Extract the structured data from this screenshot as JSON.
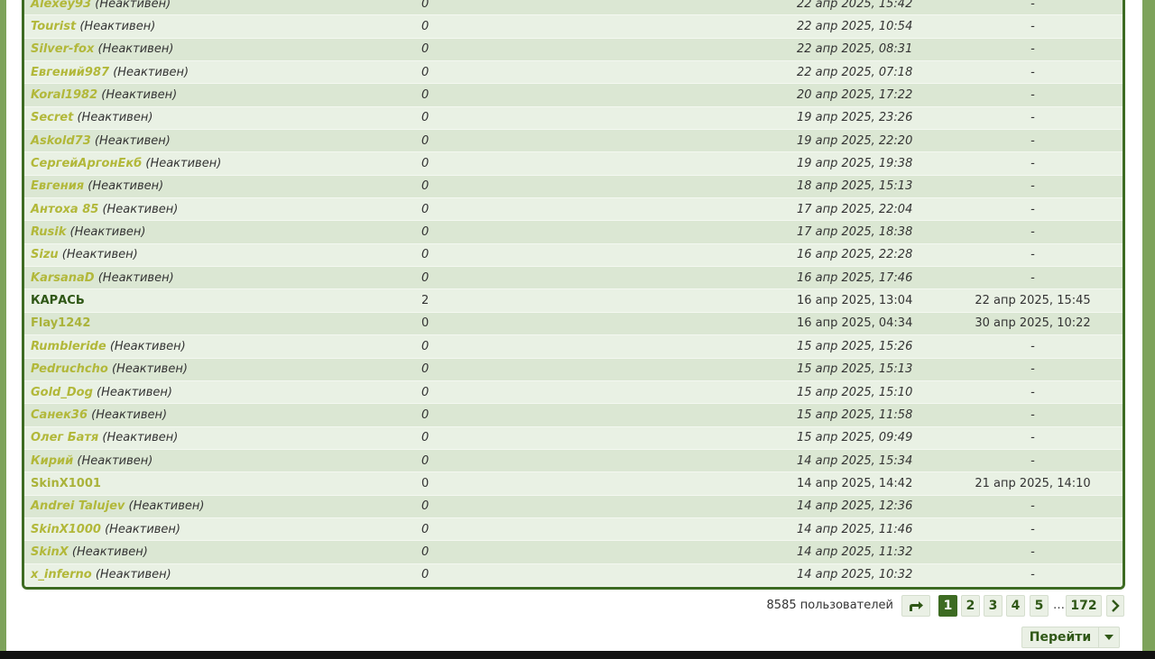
{
  "members": [
    {
      "name": "Alexey93",
      "status": "(Неактивен)",
      "messages": "0",
      "registered": "22 апр 2025, 15:42",
      "last": "-",
      "active": false
    },
    {
      "name": "Tourist",
      "status": "(Неактивен)",
      "messages": "0",
      "registered": "22 апр 2025, 10:54",
      "last": "-",
      "active": false
    },
    {
      "name": "Silver-fox",
      "status": "(Неактивен)",
      "messages": "0",
      "registered": "22 апр 2025, 08:31",
      "last": "-",
      "active": false
    },
    {
      "name": "Евгений987",
      "status": "(Неактивен)",
      "messages": "0",
      "registered": "22 апр 2025, 07:18",
      "last": "-",
      "active": false
    },
    {
      "name": "Koral1982",
      "status": "(Неактивен)",
      "messages": "0",
      "registered": "20 апр 2025, 17:22",
      "last": "-",
      "active": false
    },
    {
      "name": "Secret",
      "status": "(Неактивен)",
      "messages": "0",
      "registered": "19 апр 2025, 23:26",
      "last": "-",
      "active": false
    },
    {
      "name": "Askold73",
      "status": "(Неактивен)",
      "messages": "0",
      "registered": "19 апр 2025, 22:20",
      "last": "-",
      "active": false
    },
    {
      "name": "СергейАргонЕкб",
      "status": "(Неактивен)",
      "messages": "0",
      "registered": "19 апр 2025, 19:38",
      "last": "-",
      "active": false
    },
    {
      "name": "Евгения",
      "status": "(Неактивен)",
      "messages": "0",
      "registered": "18 апр 2025, 15:13",
      "last": "-",
      "active": false
    },
    {
      "name": "Антоха 85",
      "status": "(Неактивен)",
      "messages": "0",
      "registered": "17 апр 2025, 22:04",
      "last": "-",
      "active": false
    },
    {
      "name": "Rusik",
      "status": "(Неактивен)",
      "messages": "0",
      "registered": "17 апр 2025, 18:38",
      "last": "-",
      "active": false
    },
    {
      "name": "Sizu",
      "status": "(Неактивен)",
      "messages": "0",
      "registered": "16 апр 2025, 22:28",
      "last": "-",
      "active": false
    },
    {
      "name": "KarsanaD",
      "status": "(Неактивен)",
      "messages": "0",
      "registered": "16 апр 2025, 17:46",
      "last": "-",
      "active": false
    },
    {
      "name": "КАРАСЬ",
      "status": "",
      "messages": "2",
      "registered": "16 апр 2025, 13:04",
      "last": "22 апр 2025, 15:45",
      "active": true,
      "role": "strong"
    },
    {
      "name": "Flay1242",
      "status": "",
      "messages": "0",
      "registered": "16 апр 2025, 04:34",
      "last": "30 апр 2025, 10:22",
      "active": true,
      "role": "normal"
    },
    {
      "name": "Rumbleride",
      "status": "(Неактивен)",
      "messages": "0",
      "registered": "15 апр 2025, 15:26",
      "last": "-",
      "active": false
    },
    {
      "name": "Pedruchcho",
      "status": "(Неактивен)",
      "messages": "0",
      "registered": "15 апр 2025, 15:13",
      "last": "-",
      "active": false
    },
    {
      "name": "Gold_Dog",
      "status": "(Неактивен)",
      "messages": "0",
      "registered": "15 апр 2025, 15:10",
      "last": "-",
      "active": false
    },
    {
      "name": "Санек36",
      "status": "(Неактивен)",
      "messages": "0",
      "registered": "15 апр 2025, 11:58",
      "last": "-",
      "active": false
    },
    {
      "name": "Олег Батя",
      "status": "(Неактивен)",
      "messages": "0",
      "registered": "15 апр 2025, 09:49",
      "last": "-",
      "active": false
    },
    {
      "name": "Кирий",
      "status": "(Неактивен)",
      "messages": "0",
      "registered": "14 апр 2025, 15:34",
      "last": "-",
      "active": false
    },
    {
      "name": "SkinX1001",
      "status": "",
      "messages": "0",
      "registered": "14 апр 2025, 14:42",
      "last": "21 апр 2025, 14:10",
      "active": true,
      "role": "normal"
    },
    {
      "name": "Andrei Talujev",
      "status": "(Неактивен)",
      "messages": "0",
      "registered": "14 апр 2025, 12:36",
      "last": "-",
      "active": false
    },
    {
      "name": "SkinX1000",
      "status": "(Неактивен)",
      "messages": "0",
      "registered": "14 апр 2025, 11:46",
      "last": "-",
      "active": false
    },
    {
      "name": "SkinX",
      "status": "(Неактивен)",
      "messages": "0",
      "registered": "14 апр 2025, 11:32",
      "last": "-",
      "active": false
    },
    {
      "name": "x_inferno",
      "status": "(Неактивен)",
      "messages": "0",
      "registered": "14 апр 2025, 10:32",
      "last": "-",
      "active": false
    }
  ],
  "pagination": {
    "total": "8585 пользователей",
    "jump_icon": "jump-arrow-icon",
    "pages": [
      "1",
      "2",
      "3",
      "4",
      "5"
    ],
    "current": "1",
    "ellipsis": "…",
    "last_page": "172",
    "next_icon": "chevron-right-icon"
  },
  "goto": {
    "label": "Перейти",
    "caret_icon": "caret-down-icon"
  },
  "colors": {
    "accent": "#3d6b22",
    "username": "#b2b83a",
    "row_odd": "#dbe7d3",
    "row_even": "#e9f1e4"
  }
}
